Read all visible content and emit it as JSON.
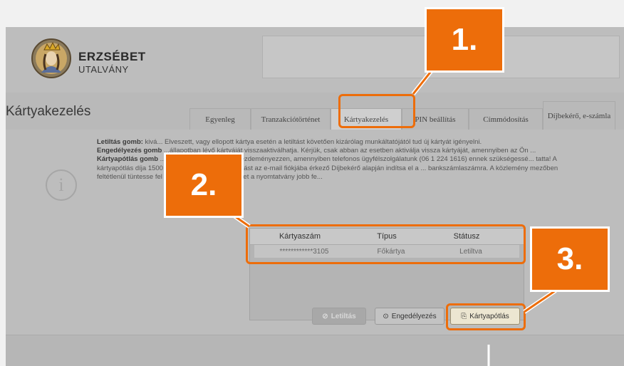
{
  "brand": {
    "title": "ERZSÉBET",
    "subtitle": "UTALVÁNY"
  },
  "page_title": "Kártyakezelés",
  "tabs": [
    {
      "label": "Egyenleg"
    },
    {
      "label": "Tranzakciótörténet"
    },
    {
      "label": "Kártyakezelés"
    },
    {
      "label": "PIN beállítás"
    },
    {
      "label": "Címmódosítás"
    },
    {
      "label": "Díjbekérő, e-számla"
    }
  ],
  "info": {
    "p1_bold": "Letiltás gomb:",
    "p1_text": " kivá... Elveszett, vagy ellopott kártya esetén a letiltást követően kizárólag munkáltatójától tud új kártyát igényelni.",
    "p2_bold": "Engedélyezés gomb",
    "p2_text": " ...állapotban lévő kártyáját visszaaktiválhatja. Kérjük, csak abban az esetben aktiválja vissza kártyáját, amennyiben az Ön ...",
    "p3_bold": "Kártyapótlás gomb",
    "p3_text": " ...csak abban az esetben kezdeményezzen, amennyiben telefonos ügyfélszolgálatunk (06 1 224 1616) ennek szükségessé... tatta! A kártyapótlás díja 1500 forint + áfa. Kérjük, az utalást az e-mail fiókjába érkező Díjbekérő alapján indítsa el a ... bankszámlaszámra. A közlemény mezőben feltétlenül tüntesse fel a díjbekérő számát, amelyet a nyomtatvány jobb fe..."
  },
  "table": {
    "headers": [
      "Kártyaszám",
      "Típus",
      "Státusz"
    ],
    "rows": [
      [
        "************3105",
        "Főkártya",
        "Letiltva"
      ]
    ]
  },
  "buttons": {
    "letiltas": "Letiltás",
    "engedelyezes": "Engedélyezés",
    "kartyapotlas": "Kártyapótlás"
  },
  "callouts": {
    "one": "1.",
    "two": "2.",
    "three": "3."
  },
  "colors": {
    "accent": "#ed6d0a",
    "overlay_gray": "#bdbdbd"
  }
}
